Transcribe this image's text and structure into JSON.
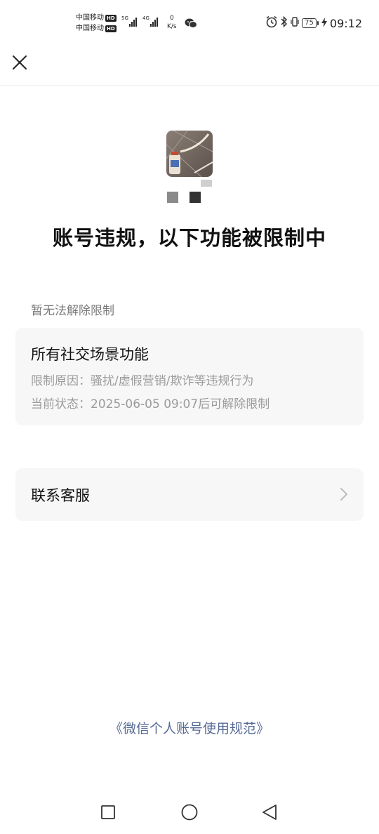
{
  "status_bar": {
    "carrier_1": "中国移动",
    "carrier_2": "中国移动",
    "hd_badge": "HD",
    "sig1_tag": "5G",
    "sig2_tag": "4G",
    "net_speed_value": "0",
    "net_speed_unit": "K/s",
    "battery": "75",
    "time": "09:12",
    "icons": [
      "wechat-notification-icon",
      "alarm-icon",
      "bluetooth-icon",
      "vibrate-icon",
      "battery-icon",
      "charging-icon"
    ]
  },
  "header": {
    "close_icon": "close-icon"
  },
  "headline": "账号违规，以下功能被限制中",
  "section_label": "暂无法解除限制",
  "restriction": {
    "title": "所有社交场景功能",
    "reason": "限制原因：骚扰/虚假营销/欺诈等违规行为",
    "status": "当前状态：2025-06-05 09:07后可解除限制"
  },
  "contact_service": {
    "label": "联系客服",
    "icon": "chevron-right-icon"
  },
  "policy_link": "《微信个人账号使用规范》",
  "navbar": {
    "icons": [
      "recent-apps-icon",
      "home-icon",
      "back-icon"
    ]
  },
  "colors": {
    "link": "#576b95",
    "card_bg": "#f7f7f7",
    "secondary_text": "#9b9b9b"
  }
}
